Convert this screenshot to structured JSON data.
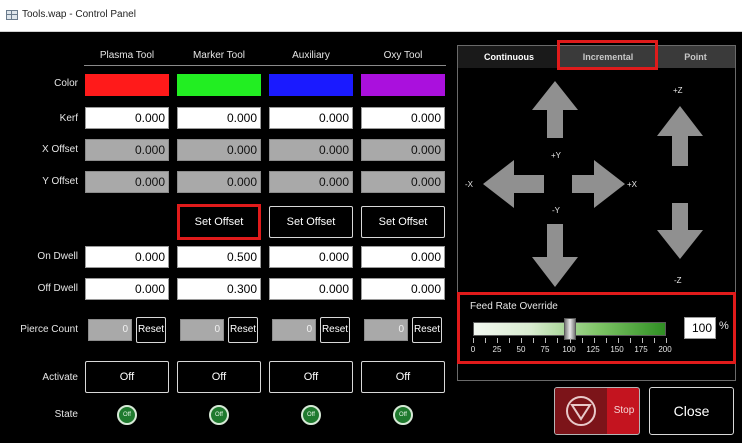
{
  "window": {
    "title": "Tools.wap - Control Panel"
  },
  "tools": [
    {
      "name": "Plasma Tool",
      "color": "#ff1a1a",
      "kerf": "0.000",
      "x_offset": "0.000",
      "y_offset": "0.000",
      "on_dwell": "0.000",
      "off_dwell": "0.000",
      "pierce_count": "0",
      "activate": "Off",
      "state": "Off"
    },
    {
      "name": "Marker Tool",
      "color": "#22ee22",
      "kerf": "0.000",
      "x_offset": "0.000",
      "y_offset": "0.000",
      "on_dwell": "0.500",
      "off_dwell": "0.300",
      "pierce_count": "0",
      "activate": "Off",
      "state": "Off",
      "set_offset": "Set Offset"
    },
    {
      "name": "Auxiliary",
      "color": "#1a1aff",
      "kerf": "0.000",
      "x_offset": "0.000",
      "y_offset": "0.000",
      "on_dwell": "0.000",
      "off_dwell": "0.000",
      "pierce_count": "0",
      "activate": "Off",
      "state": "Off",
      "set_offset": "Set Offset"
    },
    {
      "name": "Oxy Tool",
      "color": "#aa10dd",
      "kerf": "0.000",
      "x_offset": "0.000",
      "y_offset": "0.000",
      "on_dwell": "0.000",
      "off_dwell": "0.000",
      "pierce_count": "0",
      "activate": "Off",
      "state": "Off",
      "set_offset": "Set Offset"
    }
  ],
  "row_labels": {
    "color": "Color",
    "kerf": "Kerf",
    "x_offset": "X Offset",
    "y_offset": "Y Offset",
    "on_dwell": "On Dwell",
    "off_dwell": "Off Dwell",
    "pierce_count": "Pierce Count",
    "activate": "Activate",
    "state": "State"
  },
  "reset_label": "Reset",
  "jog": {
    "tabs": [
      "Continuous",
      "Incremental",
      "Point"
    ],
    "active_tab": "Continuous",
    "axes": {
      "plus_y": "+Y",
      "minus_y": "-Y",
      "plus_x": "+X",
      "minus_x": "-X",
      "plus_z": "+Z",
      "minus_z": "-Z"
    }
  },
  "feed_rate": {
    "label": "Feed Rate Override",
    "value": "100",
    "unit": "%",
    "slider_value": 100,
    "scale": [
      "0",
      "25",
      "50",
      "75",
      "100",
      "125",
      "150",
      "175",
      "200"
    ]
  },
  "buttons": {
    "stop": "Stop",
    "close": "Close"
  },
  "colors": {
    "highlight": "#e01b1b",
    "state_led": "#1f7a2e",
    "stop_red": "#c4141f"
  }
}
